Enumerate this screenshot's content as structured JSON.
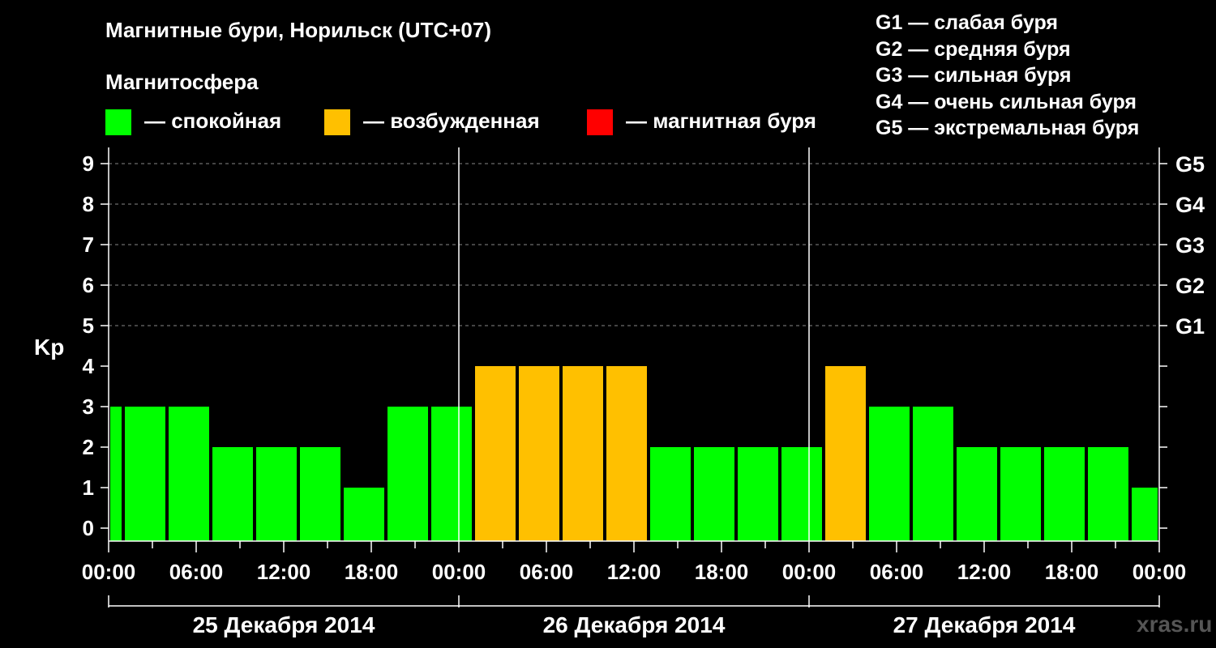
{
  "title": "Магнитные бури, Норильск (UTC+07)",
  "subtitle": "Магнитосфера",
  "legend": [
    {
      "label": "— спокойная",
      "color": "#00ff00"
    },
    {
      "label": "— возбужденная",
      "color": "#ffc000"
    },
    {
      "label": "— магнитная буря",
      "color": "#ff0000"
    }
  ],
  "storm_scale": [
    "G1 — слабая буря",
    "G2 — средняя буря",
    "G3 — сильная буря",
    "G4 — очень сильная буря",
    "G5 — экстремальная буря"
  ],
  "watermark": "xras.ru",
  "chart_data": {
    "type": "bar",
    "ylabel": "Kp",
    "ylim": [
      0,
      9
    ],
    "yticks": [
      "0",
      "1",
      "2",
      "3",
      "4",
      "5",
      "6",
      "7",
      "8",
      "9"
    ],
    "right_ticks": [
      {
        "kp": 5,
        "label": "G1"
      },
      {
        "kp": 6,
        "label": "G2"
      },
      {
        "kp": 7,
        "label": "G3"
      },
      {
        "kp": 8,
        "label": "G4"
      },
      {
        "kp": 9,
        "label": "G5"
      }
    ],
    "x_tick_labels": [
      "00:00",
      "06:00",
      "12:00",
      "18:00",
      "00:00",
      "06:00",
      "12:00",
      "18:00",
      "00:00",
      "06:00",
      "12:00",
      "18:00",
      "00:00",
      "06:00",
      "12:00",
      "18:00",
      "00:00",
      "06:00",
      "12:00",
      "18:00",
      "00:00",
      "06:00",
      "12:00",
      "18:00",
      "00:00"
    ],
    "days": [
      "25 Декабря 2014",
      "26 Декабря 2014",
      "27 Декабря 2014"
    ],
    "x_range_hours": [
      0,
      72
    ],
    "grid": true,
    "colors": {
      "quiet": "#00ff00",
      "active": "#ffc000",
      "storm": "#ff0000"
    },
    "bars": [
      {
        "start": 0,
        "end": 1,
        "kp": 3,
        "level": "quiet"
      },
      {
        "start": 1,
        "end": 4,
        "kp": 3,
        "level": "quiet"
      },
      {
        "start": 4,
        "end": 7,
        "kp": 3,
        "level": "quiet"
      },
      {
        "start": 7,
        "end": 10,
        "kp": 2,
        "level": "quiet"
      },
      {
        "start": 10,
        "end": 13,
        "kp": 2,
        "level": "quiet"
      },
      {
        "start": 13,
        "end": 16,
        "kp": 2,
        "level": "quiet"
      },
      {
        "start": 16,
        "end": 19,
        "kp": 1,
        "level": "quiet"
      },
      {
        "start": 19,
        "end": 22,
        "kp": 3,
        "level": "quiet"
      },
      {
        "start": 22,
        "end": 25,
        "kp": 3,
        "level": "quiet"
      },
      {
        "start": 25,
        "end": 28,
        "kp": 4,
        "level": "active"
      },
      {
        "start": 28,
        "end": 31,
        "kp": 4,
        "level": "active"
      },
      {
        "start": 31,
        "end": 34,
        "kp": 4,
        "level": "active"
      },
      {
        "start": 34,
        "end": 37,
        "kp": 4,
        "level": "active"
      },
      {
        "start": 37,
        "end": 40,
        "kp": 2,
        "level": "quiet"
      },
      {
        "start": 40,
        "end": 43,
        "kp": 2,
        "level": "quiet"
      },
      {
        "start": 43,
        "end": 46,
        "kp": 2,
        "level": "quiet"
      },
      {
        "start": 46,
        "end": 49,
        "kp": 2,
        "level": "quiet"
      },
      {
        "start": 49,
        "end": 52,
        "kp": 4,
        "level": "active"
      },
      {
        "start": 52,
        "end": 55,
        "kp": 3,
        "level": "quiet"
      },
      {
        "start": 55,
        "end": 58,
        "kp": 3,
        "level": "quiet"
      },
      {
        "start": 58,
        "end": 61,
        "kp": 2,
        "level": "quiet"
      },
      {
        "start": 61,
        "end": 64,
        "kp": 2,
        "level": "quiet"
      },
      {
        "start": 64,
        "end": 67,
        "kp": 2,
        "level": "quiet"
      },
      {
        "start": 67,
        "end": 70,
        "kp": 2,
        "level": "quiet"
      },
      {
        "start": 70,
        "end": 72,
        "kp": 1,
        "level": "quiet"
      }
    ]
  }
}
